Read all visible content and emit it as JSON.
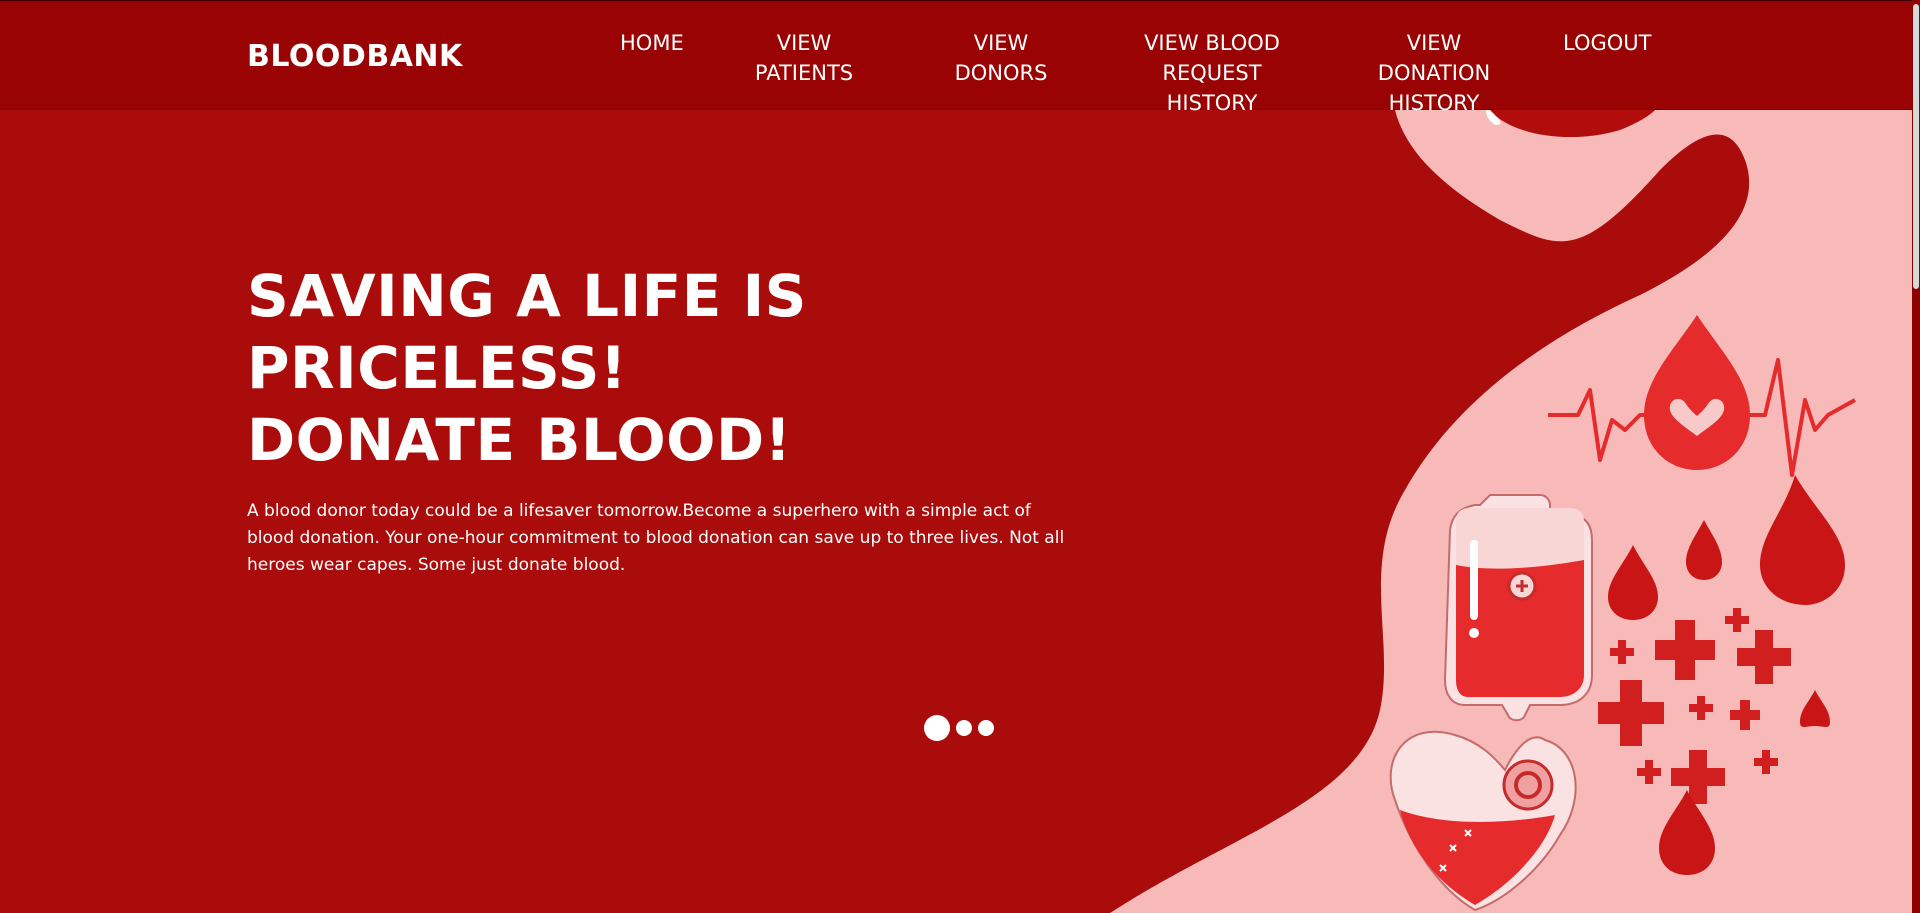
{
  "nav": {
    "brand": "BLOODBANK",
    "links": [
      {
        "line1": "HOME",
        "line2": ""
      },
      {
        "line1": "VIEW PATIENTS",
        "line2": ""
      },
      {
        "line1": "VIEW DONORS",
        "line2": ""
      },
      {
        "line1": "VIEW BLOOD",
        "line2": "REQUEST HISTORY"
      },
      {
        "line1": "VIEW DONATION",
        "line2": "HISTORY"
      },
      {
        "line1": "LOGOUT",
        "line2": ""
      }
    ]
  },
  "hero": {
    "title": "SAVING A LIFE IS PRICELESS! DONATE BLOOD!",
    "description": "A blood donor today could be a lifesaver tomorrow.Become a superhero with a simple act of blood donation. Your one-hour commitment to blood donation can save up to three lives. Not all heroes wear capes. Some just donate blood.",
    "slides_total": 3,
    "active_slide": 1
  },
  "colors": {
    "navbar": "#990303",
    "hero_background": "#aa0b0b",
    "illustration_pink": "#f8b9b9",
    "illustration_red": "#e52b2b"
  },
  "icons": [
    "heartbeat-blood-drop-icon",
    "blood-bag-icon",
    "heart-blood-bag-icon",
    "medical-cross-icon",
    "blood-drop-icon"
  ]
}
